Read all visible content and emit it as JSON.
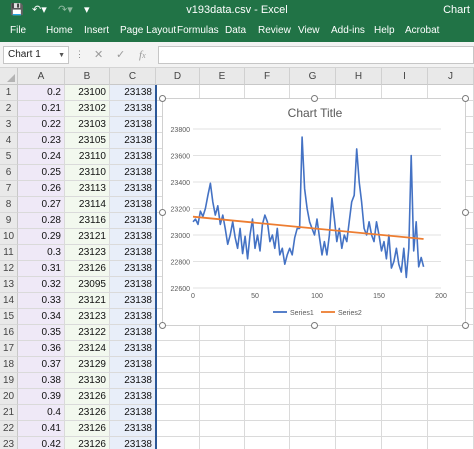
{
  "titlebar": {
    "title": "v193data.csv  -  Excel",
    "context_tab": "Chart"
  },
  "ribbon": {
    "tabs": [
      "File",
      "Home",
      "Insert",
      "Page Layout",
      "Formulas",
      "Data",
      "Review",
      "View",
      "Add-ins",
      "Help",
      "Acrobat"
    ]
  },
  "formula_bar": {
    "name_box": "Chart 1",
    "formula": ""
  },
  "columns": [
    "A",
    "B",
    "C",
    "D",
    "E",
    "F",
    "G",
    "H",
    "I",
    "J"
  ],
  "rows": [
    {
      "n": "1",
      "a": "0.2",
      "b": "23100",
      "c": "23138"
    },
    {
      "n": "2",
      "a": "0.21",
      "b": "23102",
      "c": "23138"
    },
    {
      "n": "3",
      "a": "0.22",
      "b": "23103",
      "c": "23138"
    },
    {
      "n": "4",
      "a": "0.23",
      "b": "23105",
      "c": "23138"
    },
    {
      "n": "5",
      "a": "0.24",
      "b": "23110",
      "c": "23138"
    },
    {
      "n": "6",
      "a": "0.25",
      "b": "23110",
      "c": "23138"
    },
    {
      "n": "7",
      "a": "0.26",
      "b": "23113",
      "c": "23138"
    },
    {
      "n": "8",
      "a": "0.27",
      "b": "23114",
      "c": "23138"
    },
    {
      "n": "9",
      "a": "0.28",
      "b": "23116",
      "c": "23138"
    },
    {
      "n": "10",
      "a": "0.29",
      "b": "23121",
      "c": "23138"
    },
    {
      "n": "11",
      "a": "0.3",
      "b": "23123",
      "c": "23138"
    },
    {
      "n": "12",
      "a": "0.31",
      "b": "23126",
      "c": "23138"
    },
    {
      "n": "13",
      "a": "0.32",
      "b": "23095",
      "c": "23138"
    },
    {
      "n": "14",
      "a": "0.33",
      "b": "23121",
      "c": "23138"
    },
    {
      "n": "15",
      "a": "0.34",
      "b": "23123",
      "c": "23138"
    },
    {
      "n": "16",
      "a": "0.35",
      "b": "23122",
      "c": "23138"
    },
    {
      "n": "17",
      "a": "0.36",
      "b": "23124",
      "c": "23138"
    },
    {
      "n": "18",
      "a": "0.37",
      "b": "23129",
      "c": "23138"
    },
    {
      "n": "19",
      "a": "0.38",
      "b": "23130",
      "c": "23138"
    },
    {
      "n": "20",
      "a": "0.39",
      "b": "23126",
      "c": "23138"
    },
    {
      "n": "21",
      "a": "0.4",
      "b": "23126",
      "c": "23138"
    },
    {
      "n": "22",
      "a": "0.41",
      "b": "23126",
      "c": "23138"
    },
    {
      "n": "23",
      "a": "0.42",
      "b": "23126",
      "c": "23138"
    }
  ],
  "chart_data": {
    "type": "line",
    "title": "Chart Title",
    "xlabel": "",
    "ylabel": "",
    "xlim": [
      0,
      200
    ],
    "ylim": [
      22600,
      23800
    ],
    "x_ticks": [
      "0",
      "50",
      "100",
      "150",
      "200"
    ],
    "y_ticks": [
      "22600",
      "22800",
      "23000",
      "23200",
      "23400",
      "23600",
      "23800"
    ],
    "grid": true,
    "legend": "bottom",
    "series": [
      {
        "name": "Series1",
        "color": "#4472c4",
        "x": [
          0,
          2,
          4,
          6,
          8,
          10,
          12,
          14,
          16,
          18,
          20,
          22,
          24,
          26,
          28,
          30,
          32,
          34,
          36,
          38,
          40,
          42,
          44,
          46,
          48,
          50,
          52,
          54,
          56,
          58,
          60,
          62,
          64,
          66,
          68,
          70,
          72,
          74,
          76,
          78,
          80,
          82,
          84,
          86,
          88,
          90,
          92,
          94,
          96,
          98,
          100,
          102,
          104,
          106,
          108,
          110,
          112,
          114,
          116,
          118,
          120,
          122,
          124,
          126,
          128,
          130,
          132,
          134,
          136,
          138,
          140,
          142,
          144,
          146,
          148,
          150,
          152,
          154,
          156,
          158,
          160,
          162,
          164,
          166,
          168,
          170,
          172,
          174,
          176,
          178,
          180,
          182,
          184,
          186
        ],
        "values": [
          23100,
          23120,
          23080,
          23180,
          23140,
          23200,
          23300,
          23390,
          23250,
          23150,
          23220,
          23080,
          23150,
          23050,
          22930,
          23000,
          23100,
          22980,
          22900,
          23050,
          22860,
          22990,
          22820,
          23000,
          23120,
          22900,
          23000,
          22880,
          23080,
          23150,
          23100,
          22950,
          23000,
          22900,
          23050,
          22850,
          22900,
          22780,
          22850,
          22900,
          22850,
          22980,
          23050,
          23050,
          23740,
          23350,
          23200,
          23100,
          23050,
          23000,
          23120,
          22980,
          22850,
          22950,
          22850,
          23000,
          23280,
          23120,
          22950,
          23050,
          22900,
          23000,
          22950,
          23100,
          23250,
          23300,
          23650,
          23400,
          23250,
          23050,
          23000,
          23100,
          23000,
          22950,
          23100,
          23000,
          22880,
          22950,
          22820,
          23000,
          22750,
          22800,
          22900,
          22780,
          22720,
          22900,
          22680,
          22900,
          23600,
          22880,
          23100,
          22760,
          22830,
          22760
        ]
      },
      {
        "name": "Series2",
        "color": "#ed7d31",
        "x": [
          0,
          186
        ],
        "values": [
          23138,
          22970
        ]
      }
    ]
  }
}
